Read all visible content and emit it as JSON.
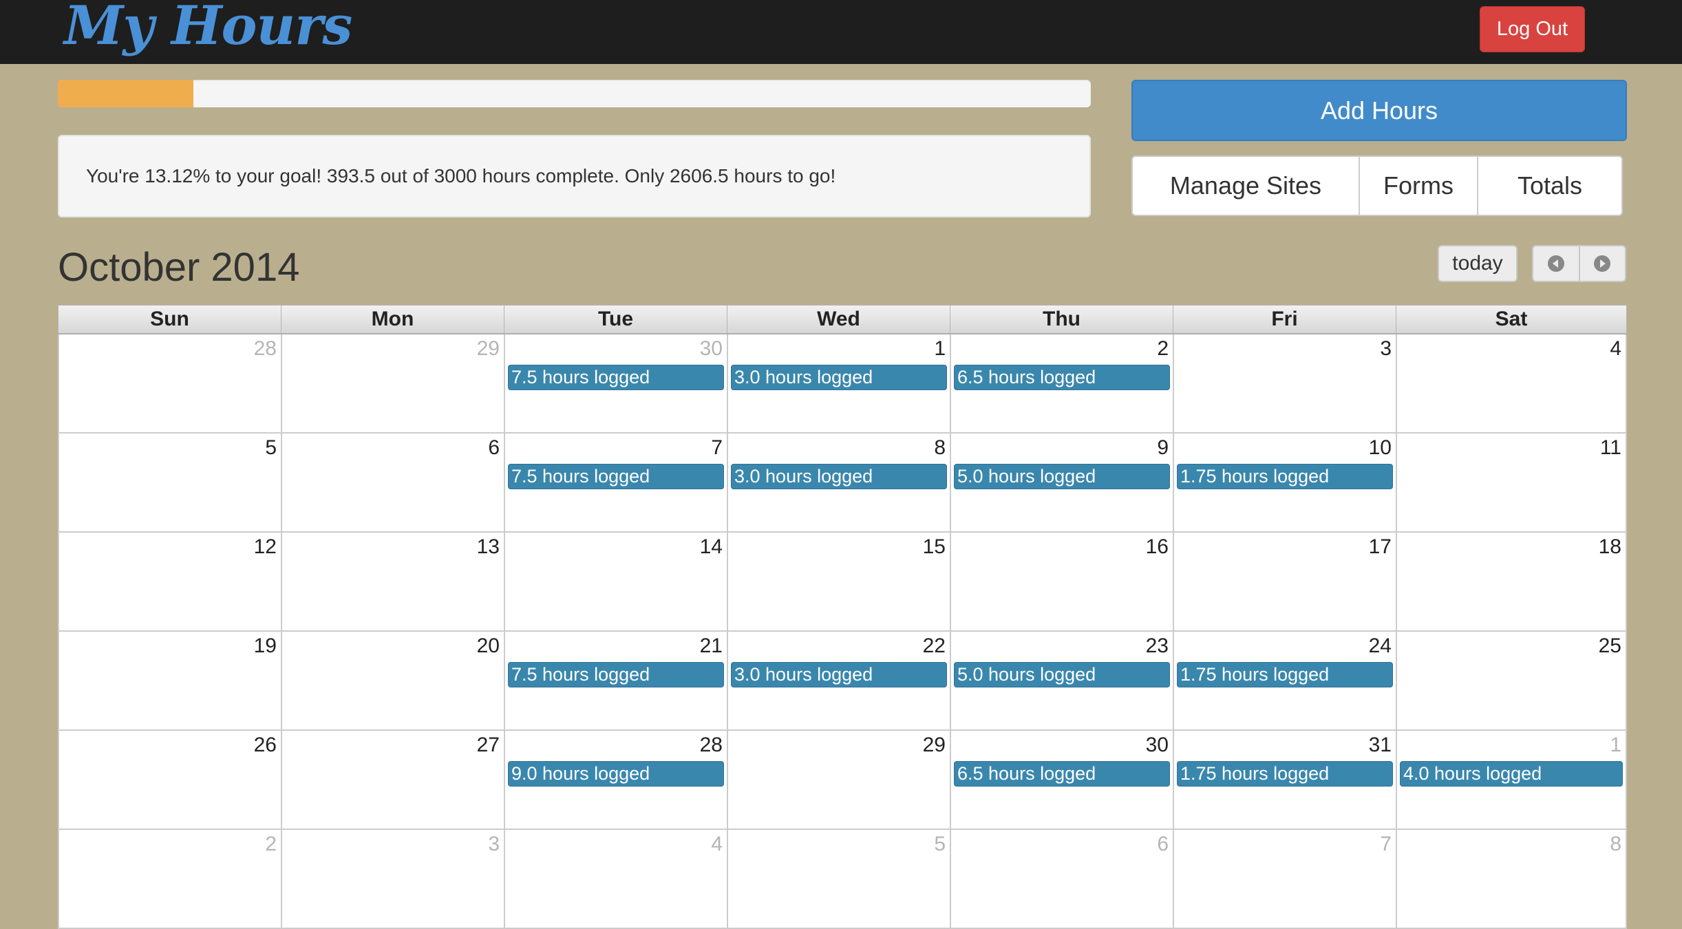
{
  "app": {
    "brand": "My Hours",
    "logout_label": "Log Out"
  },
  "progress": {
    "percent": 13.12,
    "color": "#f0ad4e"
  },
  "goal": {
    "message": "You're 13.12% to your goal! 393.5 out of 3000 hours complete. Only 2606.5 hours to go!"
  },
  "actions": {
    "add_hours_label": "Add Hours",
    "nav": [
      {
        "label": "Manage Sites",
        "name": "manage-sites-button"
      },
      {
        "label": "Forms",
        "name": "forms-button"
      },
      {
        "label": "Totals",
        "name": "totals-button"
      }
    ]
  },
  "calendar": {
    "title": "October 2014",
    "today_label": "today",
    "prev_icon": "chevron-left-circle-icon",
    "next_icon": "chevron-right-circle-icon",
    "days_of_week": [
      "Sun",
      "Mon",
      "Tue",
      "Wed",
      "Thu",
      "Fri",
      "Sat"
    ],
    "event_color": "#3a87ad",
    "weeks": [
      [
        {
          "day": "28",
          "other": true
        },
        {
          "day": "29",
          "other": true
        },
        {
          "day": "30",
          "other": true,
          "event": "7.5 hours logged"
        },
        {
          "day": "1",
          "event": "3.0 hours logged"
        },
        {
          "day": "2",
          "event": "6.5 hours logged"
        },
        {
          "day": "3"
        },
        {
          "day": "4"
        }
      ],
      [
        {
          "day": "5"
        },
        {
          "day": "6"
        },
        {
          "day": "7",
          "event": "7.5 hours logged"
        },
        {
          "day": "8",
          "event": "3.0 hours logged"
        },
        {
          "day": "9",
          "event": "5.0 hours logged"
        },
        {
          "day": "10",
          "event": "1.75 hours logged"
        },
        {
          "day": "11"
        }
      ],
      [
        {
          "day": "12"
        },
        {
          "day": "13"
        },
        {
          "day": "14"
        },
        {
          "day": "15"
        },
        {
          "day": "16"
        },
        {
          "day": "17"
        },
        {
          "day": "18"
        }
      ],
      [
        {
          "day": "19"
        },
        {
          "day": "20"
        },
        {
          "day": "21",
          "event": "7.5 hours logged"
        },
        {
          "day": "22",
          "event": "3.0 hours logged"
        },
        {
          "day": "23",
          "event": "5.0 hours logged"
        },
        {
          "day": "24",
          "event": "1.75 hours logged"
        },
        {
          "day": "25"
        }
      ],
      [
        {
          "day": "26"
        },
        {
          "day": "27"
        },
        {
          "day": "28",
          "event": "9.0 hours logged"
        },
        {
          "day": "29"
        },
        {
          "day": "30",
          "event": "6.5 hours logged"
        },
        {
          "day": "31",
          "event": "1.75 hours logged"
        },
        {
          "day": "1",
          "other": true,
          "event": "4.0 hours logged"
        }
      ],
      [
        {
          "day": "2",
          "other": true
        },
        {
          "day": "3",
          "other": true
        },
        {
          "day": "4",
          "other": true
        },
        {
          "day": "5",
          "other": true
        },
        {
          "day": "6",
          "other": true
        },
        {
          "day": "7",
          "other": true
        },
        {
          "day": "8",
          "other": true
        }
      ]
    ]
  }
}
